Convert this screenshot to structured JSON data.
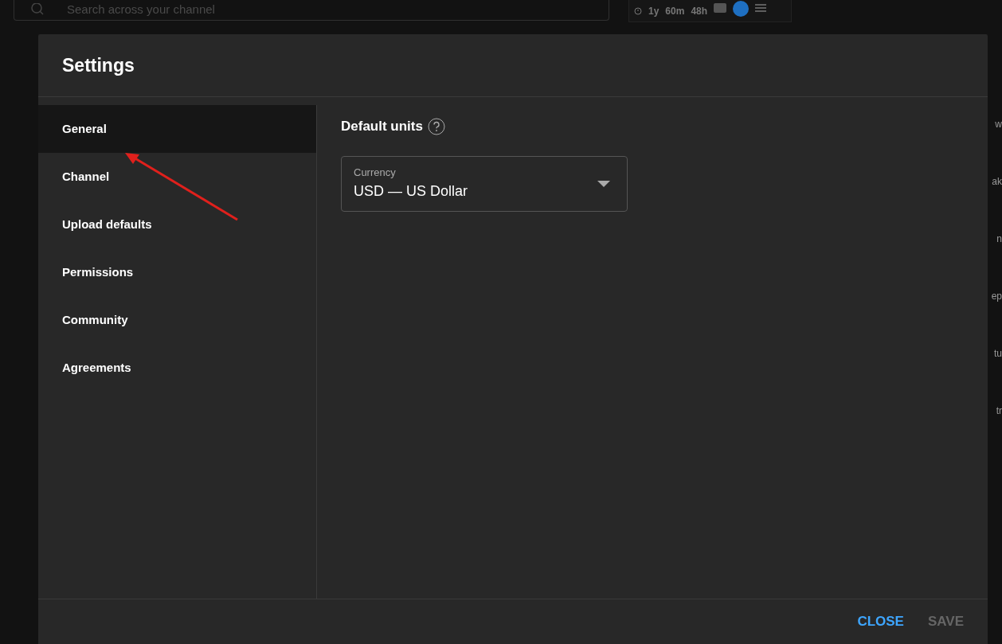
{
  "topbar": {
    "search": {
      "placeholder": "Search across your channel"
    },
    "stats": [
      "1y",
      "60m",
      "48h"
    ]
  },
  "background_fragments": [
    "w",
    "ak",
    "n",
    "ep",
    "tu",
    "tr"
  ],
  "dialog": {
    "title": "Settings",
    "sidebar": [
      {
        "label": "General",
        "selected": true
      },
      {
        "label": "Channel",
        "selected": false
      },
      {
        "label": "Upload defaults",
        "selected": false
      },
      {
        "label": "Permissions",
        "selected": false
      },
      {
        "label": "Community",
        "selected": false
      },
      {
        "label": "Agreements",
        "selected": false
      }
    ],
    "section_title": "Default units",
    "currency": {
      "label": "Currency",
      "value": "USD — US Dollar"
    },
    "buttons": [
      {
        "label": "CLOSE",
        "disabled": false
      },
      {
        "label": "SAVE",
        "disabled": true
      }
    ]
  },
  "annotation": {
    "kind": "arrow"
  }
}
